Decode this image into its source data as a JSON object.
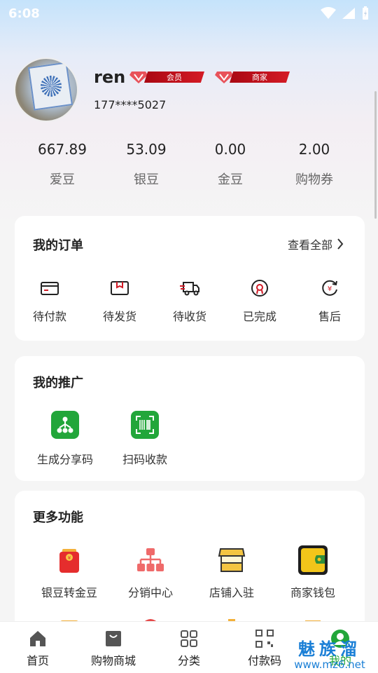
{
  "status_bar": {
    "time": "6:08"
  },
  "profile": {
    "username": "ren",
    "phone": "177****5027",
    "badges": [
      {
        "label": "会员"
      },
      {
        "label": "商家"
      }
    ]
  },
  "stats": [
    {
      "value": "667.89",
      "label": "爱豆"
    },
    {
      "value": "53.09",
      "label": "银豆"
    },
    {
      "value": "0.00",
      "label": "金豆"
    },
    {
      "value": "2.00",
      "label": "购物券"
    }
  ],
  "orders": {
    "title": "我的订单",
    "view_all": "查看全部",
    "items": [
      {
        "label": "待付款",
        "icon": "wallet-icon"
      },
      {
        "label": "待发货",
        "icon": "box-icon"
      },
      {
        "label": "待收货",
        "icon": "truck-icon"
      },
      {
        "label": "已完成",
        "icon": "done-icon"
      },
      {
        "label": "售后",
        "icon": "refund-icon"
      }
    ]
  },
  "promotion": {
    "title": "我的推广",
    "items": [
      {
        "label": "生成分享码",
        "icon": "share-tree-icon"
      },
      {
        "label": "扫码收款",
        "icon": "barcode-scan-icon"
      }
    ]
  },
  "more": {
    "title": "更多功能",
    "items": [
      {
        "label": "银豆转金豆",
        "icon": "red-envelope-icon"
      },
      {
        "label": "分销中心",
        "icon": "org-chart-icon"
      },
      {
        "label": "店铺入驻",
        "icon": "shop-icon"
      },
      {
        "label": "商家钱包",
        "icon": "yellow-wallet-icon"
      }
    ]
  },
  "tabbar": {
    "items": [
      {
        "label": "首页",
        "icon": "home-icon"
      },
      {
        "label": "购物商城",
        "icon": "shopping-bag-icon"
      },
      {
        "label": "分类",
        "icon": "grid-icon"
      },
      {
        "label": "付款码",
        "icon": "barcode-icon"
      },
      {
        "label": "我的",
        "icon": "user-icon"
      }
    ]
  },
  "watermark": {
    "top": "魅族溜",
    "bottom": "www.mz6.net"
  },
  "colors": {
    "accent": "#22a63a",
    "badge_red": "#c8101b"
  }
}
